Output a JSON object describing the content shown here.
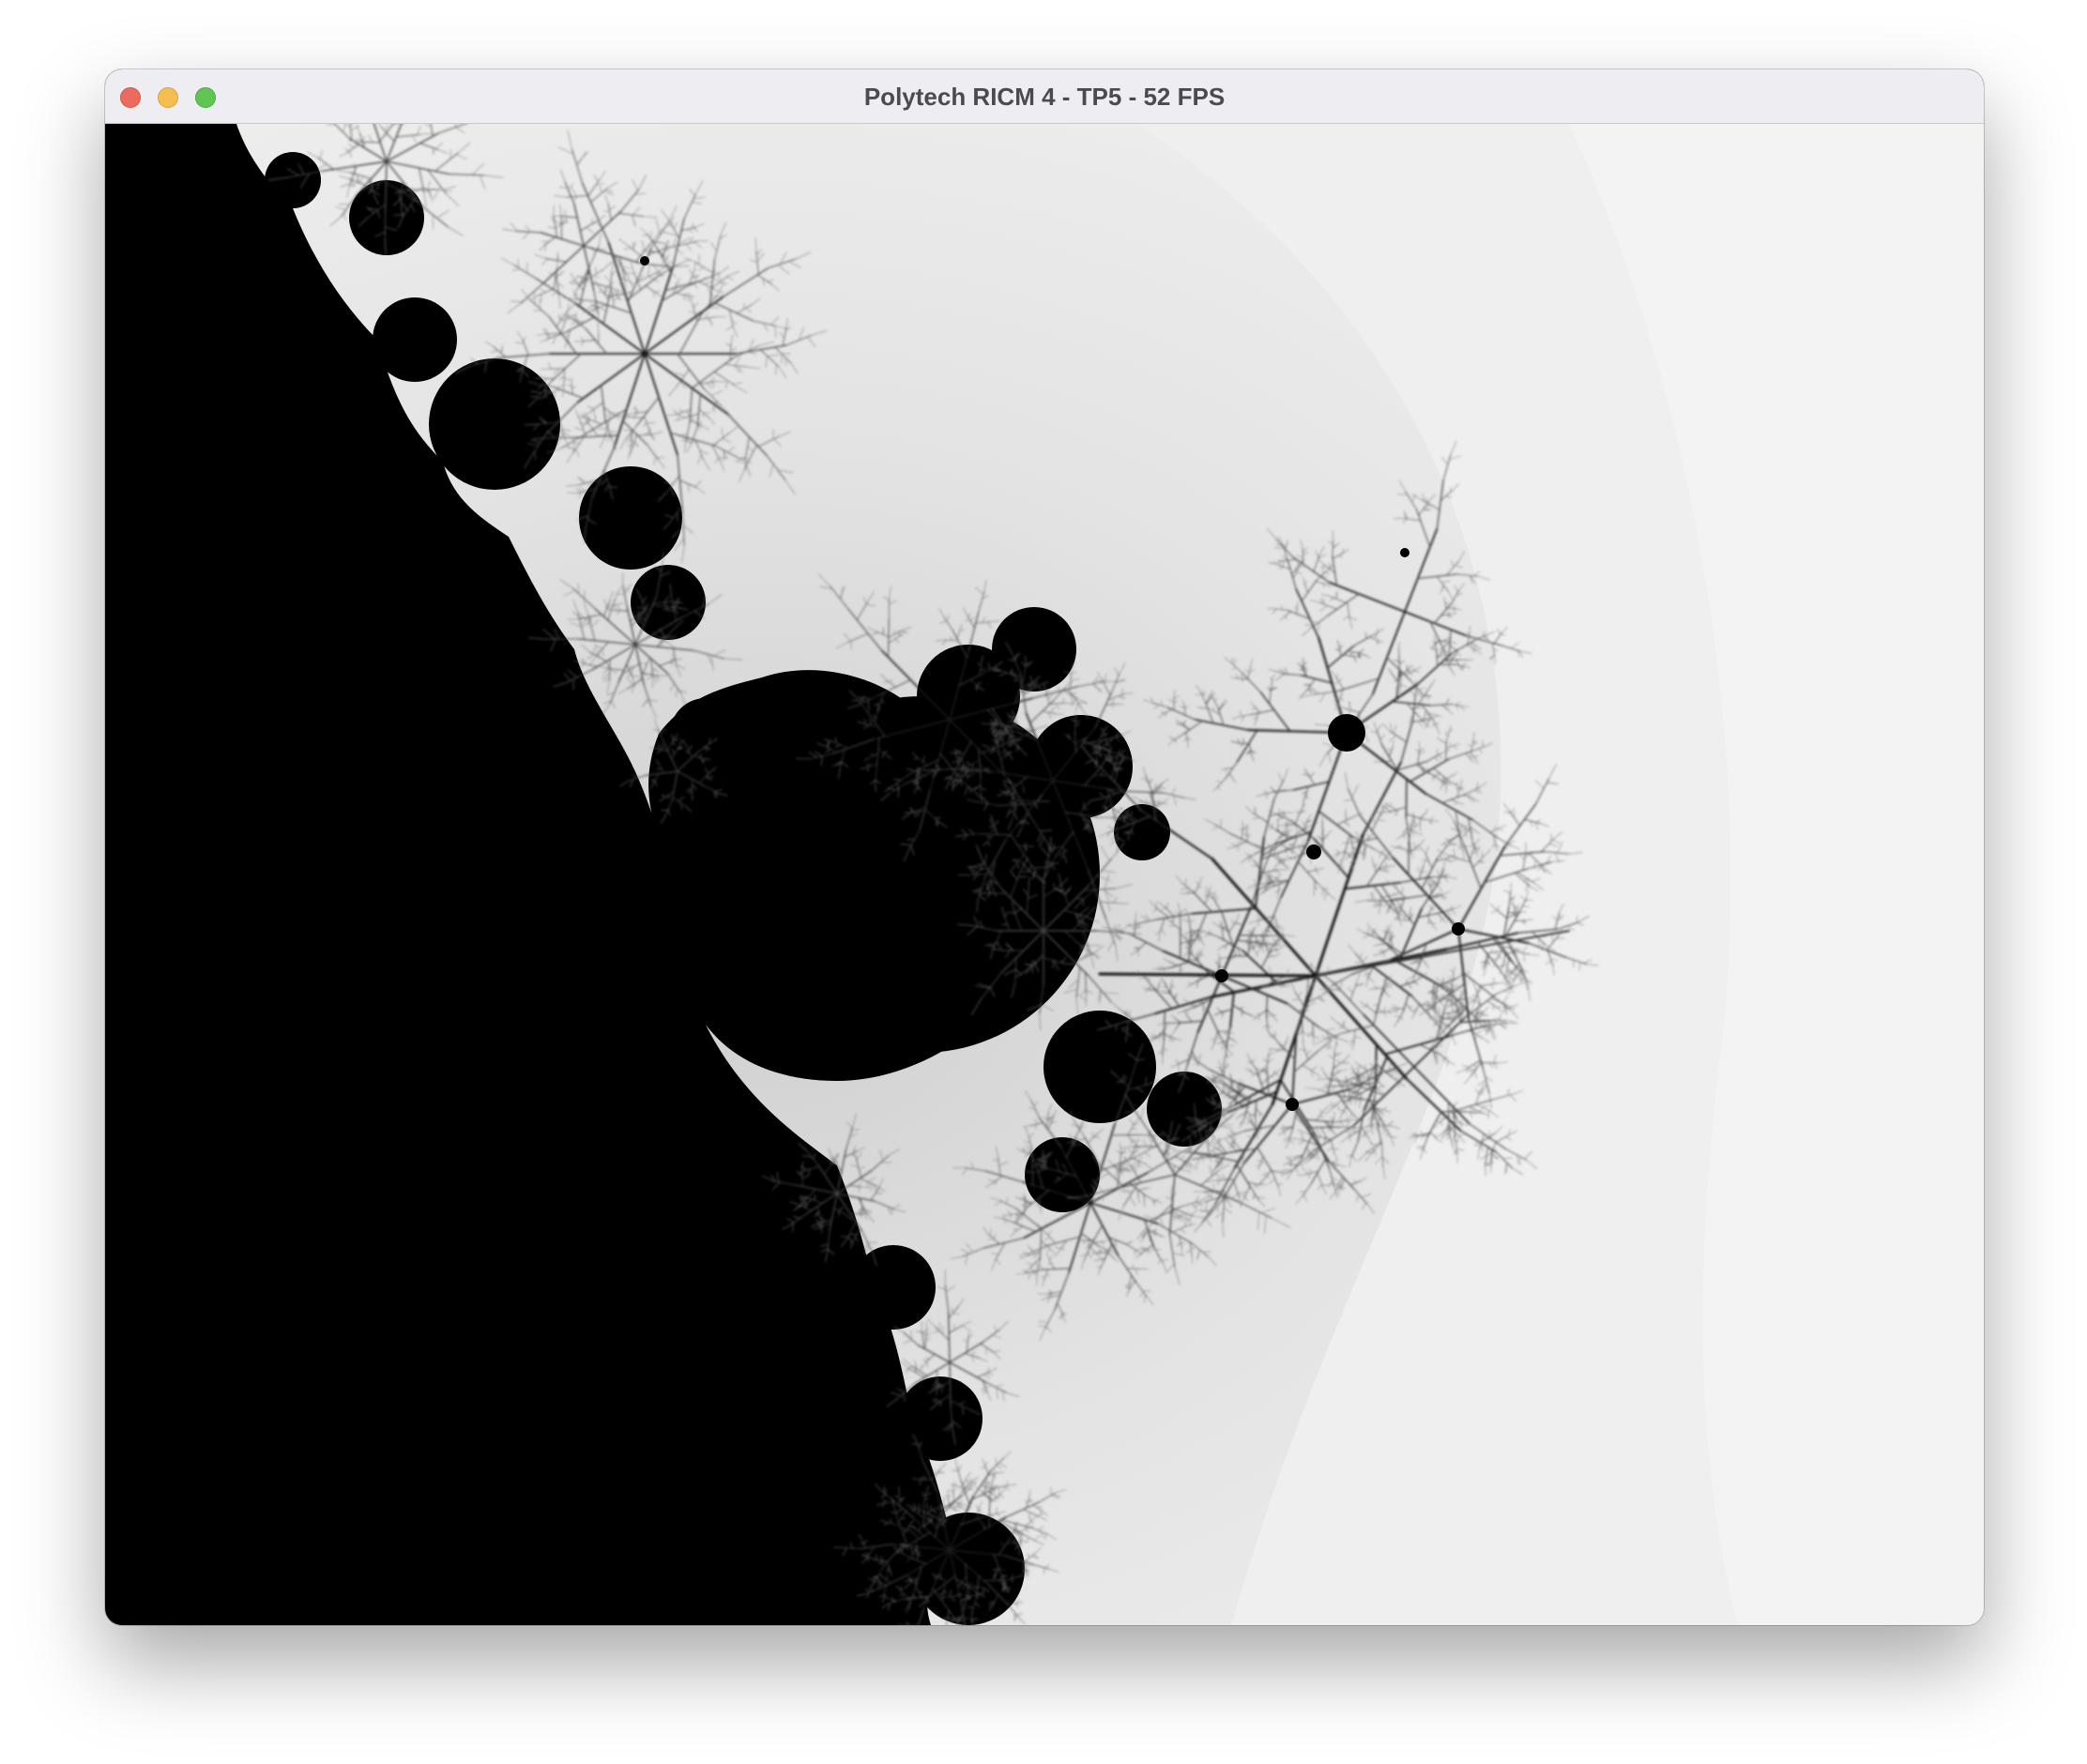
{
  "window": {
    "title": "Polytech RICM 4 - TP5 - 52 FPS",
    "controls": [
      {
        "name": "close",
        "color": "#ed6a5e"
      },
      {
        "name": "minimize",
        "color": "#f5bf4f"
      },
      {
        "name": "maximize",
        "color": "#61c554"
      }
    ]
  },
  "render": {
    "content": "mandelbrot-fractal",
    "palette": {
      "set_color": "#000000",
      "near_color": "#b8b8b8",
      "far_color": "#f2f2f2"
    }
  }
}
